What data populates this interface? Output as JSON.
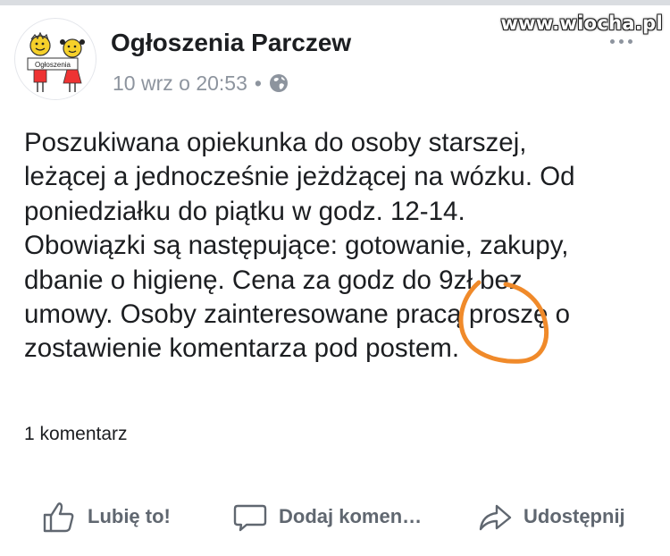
{
  "watermark": "www.wiocha.pl",
  "post": {
    "page_name": "Ogłoszenia Parczew",
    "avatar_text": "Ogłoszenia",
    "timestamp": "10 wrz o 20:53",
    "separator": "•",
    "privacy_icon": "globe-icon",
    "lines": [
      "Poszukiwana opiekunka do osoby starszej,",
      "leżącej a jednocześnie jeżdżącej na wózku. Od",
      "poniedziałku do piątku w godz. 12-14.",
      "Obowiązki są następujące: gotowanie, zakupy,",
      "dbanie o higienę. Cena za godz do 9zł bez",
      "umowy. Osoby zainteresowane pracą proszę o",
      "zostawienie komentarza pod postem."
    ],
    "comment_count": "1 komentarz",
    "highlight_color": "#f08a2a"
  },
  "actions": {
    "like": "Lubię to!",
    "comment": "Dodaj komen…",
    "share": "Udostępnij"
  }
}
